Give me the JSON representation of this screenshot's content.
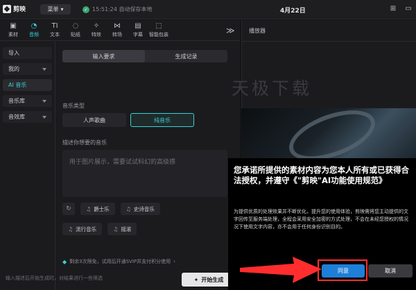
{
  "app": {
    "logo_text": "剪映"
  },
  "topbar": {
    "menu_label": "菜单",
    "save_status": "15:51:24 自动保存本地",
    "project_title": "4月22日"
  },
  "toolbar": {
    "tools": [
      {
        "label": "素材",
        "icon": "media-icon",
        "glyph": "▣",
        "active": false
      },
      {
        "label": "音频",
        "icon": "audio-icon",
        "glyph": "◔",
        "active": true
      },
      {
        "label": "文本",
        "icon": "text-icon",
        "glyph": "TI",
        "active": false
      },
      {
        "label": "贴纸",
        "icon": "sticker-icon",
        "glyph": "◌",
        "active": false
      },
      {
        "label": "特效",
        "icon": "effects-icon",
        "glyph": "✧",
        "active": false
      },
      {
        "label": "转场",
        "icon": "transition-icon",
        "glyph": "⋈",
        "active": false
      },
      {
        "label": "字幕",
        "icon": "subtitle-icon",
        "glyph": "▤",
        "active": false
      },
      {
        "label": "智能包装",
        "icon": "smart-pack-icon",
        "glyph": "⬚",
        "active": false
      }
    ],
    "more": "≫"
  },
  "sidebar": {
    "items": [
      {
        "label": "导入",
        "has_caret": false,
        "active": false
      },
      {
        "label": "我的",
        "has_caret": true,
        "active": false
      },
      {
        "label": "AI 音乐",
        "has_caret": false,
        "active": true
      },
      {
        "label": "音乐库",
        "has_caret": true,
        "active": false
      },
      {
        "label": "音效库",
        "has_caret": true,
        "active": false
      }
    ]
  },
  "content": {
    "tabs": [
      "输入要求",
      "生成记录"
    ],
    "music_type_label": "音乐类型",
    "type_vocal": "人声歌曲",
    "type_instrumental": "纯音乐",
    "describe_label": "描述你想要的音乐",
    "prompt_text": "用于图片展示，需要试试科幻的高级感",
    "chips": [
      "爵士乐",
      "史诗音乐",
      "流行音乐",
      "摇滚"
    ],
    "quota_text": "剩余3次限免，试用后开通SVIP并支付积分使用",
    "footer_note": "输入描述后开始生成时，对结果进行一些筛选",
    "generate_label": "开始生成"
  },
  "player": {
    "title": "播放器",
    "watermark": "天极下载"
  },
  "dialog": {
    "title": "您承诺所提供的素材内容为您本人所有或已获得合法授权，并遵守《\"剪映\"AI功能使用规范》",
    "body": "为提供优质的处理效果并不断优化，提升您的使用体验，剪映需将您主动提供的文字回传至服务端处理，全程会采用安全加密的方式处理，不会在未经您授权的情况况下使用文字内容，亦不会用于任何身份识别目的。",
    "agree_label": "同意",
    "cancel_label": "取消"
  },
  "colors": {
    "accent": "#39d3d6",
    "primary_button": "#1e7fd8",
    "highlight": "#ff2d2d"
  }
}
